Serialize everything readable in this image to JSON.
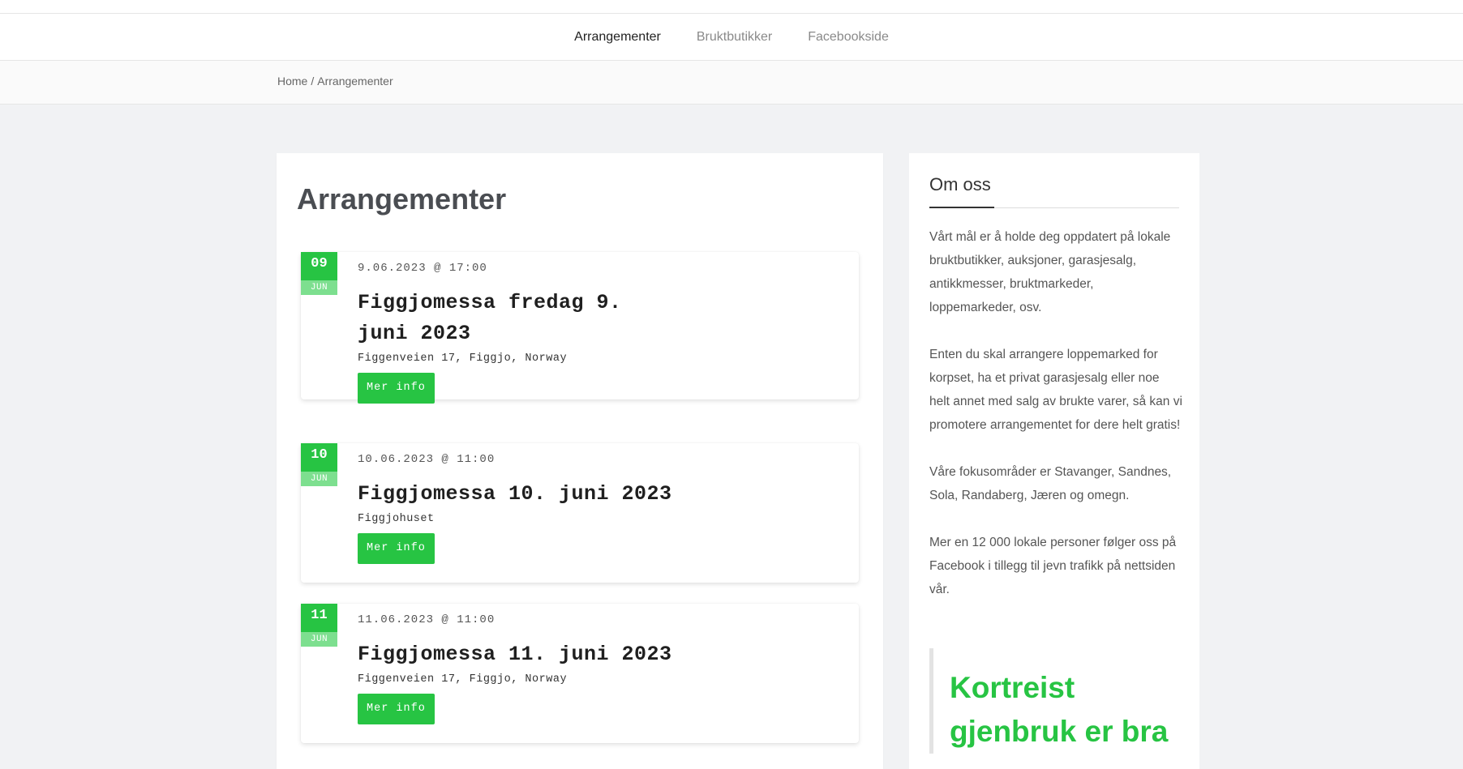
{
  "nav": {
    "items": [
      {
        "label": "Arrangementer",
        "active": true
      },
      {
        "label": "Bruktbutikker",
        "active": false
      },
      {
        "label": "Facebookside",
        "active": false
      }
    ]
  },
  "breadcrumb": {
    "home": "Home",
    "separator": "/",
    "current": "Arrangementer"
  },
  "main": {
    "title": "Arrangementer",
    "events": [
      {
        "day": "09",
        "month": "JUN",
        "datetime": "9.06.2023 @ 17:00",
        "title": "Figgjomessa fredag 9. juni 2023",
        "location": "Figgenveien 17, Figgjo, Norway",
        "button": "Mer info"
      },
      {
        "day": "10",
        "month": "JUN",
        "datetime": "10.06.2023 @ 11:00",
        "title": "Figgjomessa 10. juni 2023",
        "location": "Figgjohuset",
        "button": "Mer info"
      },
      {
        "day": "11",
        "month": "JUN",
        "datetime": "11.06.2023 @ 11:00",
        "title": "Figgjomessa 11. juni 2023",
        "location": "Figgenveien 17, Figgjo, Norway",
        "button": "Mer info"
      }
    ]
  },
  "sidebar": {
    "title": "Om oss",
    "paragraphs": [
      "Vårt mål er å holde deg oppdatert på lokale bruktbutikker, auksjoner, garasjesalg, antikkmesser, bruktmarkeder, loppemarkeder, osv.",
      "Enten du skal arrangere loppemarked for korpset, ha et privat garasjesalg eller noe helt annet med salg av brukte varer, så kan vi promotere arrangementet for dere helt gratis!",
      "Våre fokusområder er Stavanger, Sandnes, Sola, Randaberg, Jæren og omegn.",
      "Mer en 12 000 lokale personer følger oss på Facebook i tillegg til jevn trafikk på nettsiden vår."
    ],
    "quote": "Kortreist gjenbruk er bra"
  },
  "colors": {
    "accent": "#27c443",
    "accent_light": "#7ddf8f",
    "background": "#f1f2f4"
  }
}
